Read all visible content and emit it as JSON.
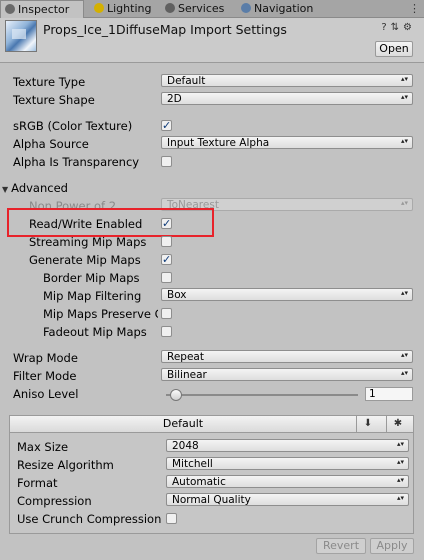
{
  "tabs": [
    {
      "label": "Inspector",
      "icon": "inspector-icon",
      "active": true
    },
    {
      "label": "Lighting",
      "icon": "lighting-icon",
      "active": false
    },
    {
      "label": "Services",
      "icon": "services-icon",
      "active": false
    },
    {
      "label": "Navigation",
      "icon": "navigation-icon",
      "active": false
    }
  ],
  "header": {
    "title": "Props_Ice_1DiffuseMap Import Settings",
    "open_label": "Open"
  },
  "settings": {
    "texture_type": {
      "label": "Texture Type",
      "value": "Default"
    },
    "texture_shape": {
      "label": "Texture Shape",
      "value": "2D"
    },
    "srgb": {
      "label": "sRGB (Color Texture)",
      "checked": true
    },
    "alpha_source": {
      "label": "Alpha Source",
      "value": "Input Texture Alpha"
    },
    "alpha_transparency": {
      "label": "Alpha Is Transparency",
      "checked": false
    },
    "advanced": {
      "label": "Advanced"
    },
    "non_power": {
      "label": "Non Power of 2",
      "value": "ToNearest"
    },
    "read_write": {
      "label": "Read/Write Enabled",
      "checked": true
    },
    "streaming_mip": {
      "label": "Streaming Mip Maps",
      "checked": false
    },
    "generate_mip": {
      "label": "Generate Mip Maps",
      "checked": true
    },
    "border_mip": {
      "label": "Border Mip Maps",
      "checked": false
    },
    "mip_filtering": {
      "label": "Mip Map Filtering",
      "value": "Box"
    },
    "mip_preserve": {
      "label": "Mip Maps Preserve C",
      "checked": false
    },
    "fadeout_mip": {
      "label": "Fadeout Mip Maps",
      "checked": false
    },
    "wrap_mode": {
      "label": "Wrap Mode",
      "value": "Repeat"
    },
    "filter_mode": {
      "label": "Filter Mode",
      "value": "Bilinear"
    },
    "aniso_level": {
      "label": "Aniso Level",
      "value": "1"
    }
  },
  "platform": {
    "tab_label": "Default",
    "max_size": {
      "label": "Max Size",
      "value": "2048"
    },
    "resize": {
      "label": "Resize Algorithm",
      "value": "Mitchell"
    },
    "format": {
      "label": "Format",
      "value": "Automatic"
    },
    "compression": {
      "label": "Compression",
      "value": "Normal Quality"
    },
    "crunch": {
      "label": "Use Crunch Compression",
      "checked": false
    }
  },
  "footer": {
    "revert_label": "Revert",
    "apply_label": "Apply"
  },
  "colors": {
    "highlight": "#e8222a",
    "check": "#0e3a78"
  }
}
